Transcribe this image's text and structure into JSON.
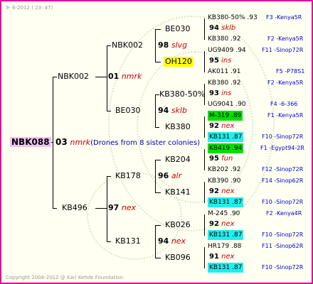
{
  "header": "9-  6-2012 ( 23: 47)",
  "footer": "Copyright 2004-2012 @ Karl Kehde Foundation.",
  "colors": {
    "frame": "#e5009e",
    "root_bg": "#f2c2f2",
    "highlight_yellow": "#ffff00",
    "highlight_green": "#00e000",
    "highlight_cyan": "#22eeee",
    "queen_red": "#cc0000",
    "ref_blue": "#0000cc"
  },
  "root": {
    "name": "NBK088",
    "year": "03",
    "queen": "nmrk",
    "note": "(Drones from 8 sister colonies)"
  },
  "gen1": [
    {
      "name": "NBK002",
      "year": "01",
      "queen": "nmrk"
    },
    {
      "name": "KB496",
      "year": "97",
      "queen": "nex"
    }
  ],
  "gen2": [
    {
      "name": "NBK002",
      "year": "98",
      "queen": "slvg"
    },
    {
      "name": "BE030",
      "year": "94",
      "queen": "sklb"
    },
    {
      "name": "KB178",
      "year": "96",
      "queen": "alr"
    },
    {
      "name": "KB131",
      "year": "94",
      "queen": "nex"
    }
  ],
  "gen3": [
    {
      "name": "BE030"
    },
    {
      "name": "OH120"
    },
    {
      "name": "KB380-50%"
    },
    {
      "name": "KB380"
    },
    {
      "name": "KB204"
    },
    {
      "name": "KB141"
    },
    {
      "name": "KB026"
    },
    {
      "name": "KB096"
    }
  ],
  "gen4": [
    {
      "name": "KB380-50%",
      "year": ".93",
      "ref": "F3 -Kenya5R"
    },
    {
      "year": "94",
      "queen": "sklb"
    },
    {
      "name": "KB380",
      "year": ".92",
      "ref": "F2 -Kenya5R"
    },
    {
      "name": "UG9409",
      "year": ".94",
      "ref": "F11 -Sinop72R"
    },
    {
      "year": "95",
      "queen": "ins"
    },
    {
      "name": "AK011",
      "year": ".91",
      "ref": "F5 -P78S1"
    },
    {
      "name": "KB380",
      "year": ".92",
      "ref": "F2 -Kenya5R"
    },
    {
      "year": "93",
      "queen": "ins"
    },
    {
      "name": "UG9041",
      "year": ".90",
      "ref": "F4 -6-366"
    },
    {
      "name": "M-319",
      "year": ".89",
      "ref": "F1 -Kenya5R"
    },
    {
      "year": "92",
      "queen": "nex"
    },
    {
      "name": "KB131",
      "year": ".87",
      "ref": "F10 -Sinop72R"
    },
    {
      "name": "KB419",
      "year": ".94",
      "ref": "F1 -Egypt94-2R"
    },
    {
      "year": "95",
      "queen": "fun"
    },
    {
      "name": "KB202",
      "year": ".92",
      "ref": "F12 -Sinop72R"
    },
    {
      "name": "KB390",
      "year": ".90",
      "ref": "F14 -Sinop62R"
    },
    {
      "year": "92",
      "queen": "nex"
    },
    {
      "name": "KB131",
      "year": ".87",
      "ref": "F10 -Sinop72R"
    },
    {
      "name": "M-245",
      "year": ".90",
      "ref": "F2 -Kenya4R"
    },
    {
      "year": "92",
      "queen": "nex"
    },
    {
      "name": "KB131",
      "year": ".87",
      "ref": "F10 -Sinop72R"
    },
    {
      "name": "HR179",
      "year": ".88",
      "ref": "F11 -Sinop62R"
    },
    {
      "year": "91",
      "queen": "nex"
    },
    {
      "name": "KB131",
      "year": ".87",
      "ref": "F10 -Sinop72R"
    }
  ]
}
